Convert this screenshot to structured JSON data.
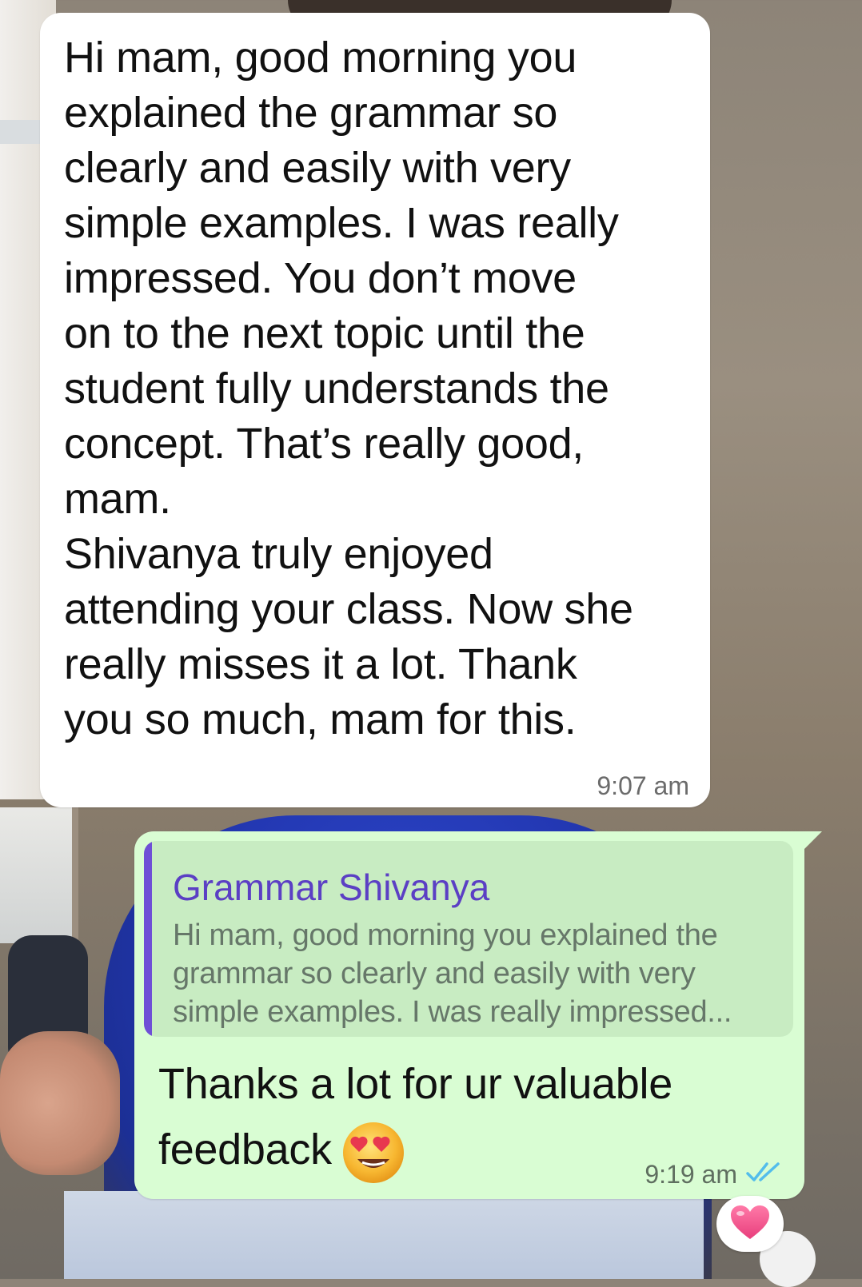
{
  "incoming_message": {
    "text": "Hi mam, good morning  you\nexplained the grammar so\nclearly and easily with very\nsimple examples. I was really\nimpressed. You don’t move\non to the next topic until the\nstudent fully understands the\nconcept. That’s really good,\nmam.\n Shivanya truly enjoyed\nattending your class. Now she\nreally misses it a lot. Thank\nyou so much,  mam for this.",
    "time": "9:07 am"
  },
  "outgoing_message": {
    "quoted": {
      "author": "Grammar Shivanya",
      "snippet_line1": "Hi mam, good morning  you explained the",
      "snippet_line2": "grammar so clearly and easily with very",
      "snippet_line3": "simple examples. I was really impressed..."
    },
    "text_line1": "Thanks a lot for ur valuable",
    "text_line2": "feedback",
    "emoji": "smiling-face-with-heart-eyes",
    "time": "9:19 am",
    "status": "read-double-check",
    "status_color": "#53bdeb"
  },
  "reaction": {
    "emoji": "pink-heart"
  },
  "colors": {
    "incoming_bubble": "#ffffff",
    "outgoing_bubble": "#d9fdd3",
    "quote_accent": "#6f4fd6"
  }
}
